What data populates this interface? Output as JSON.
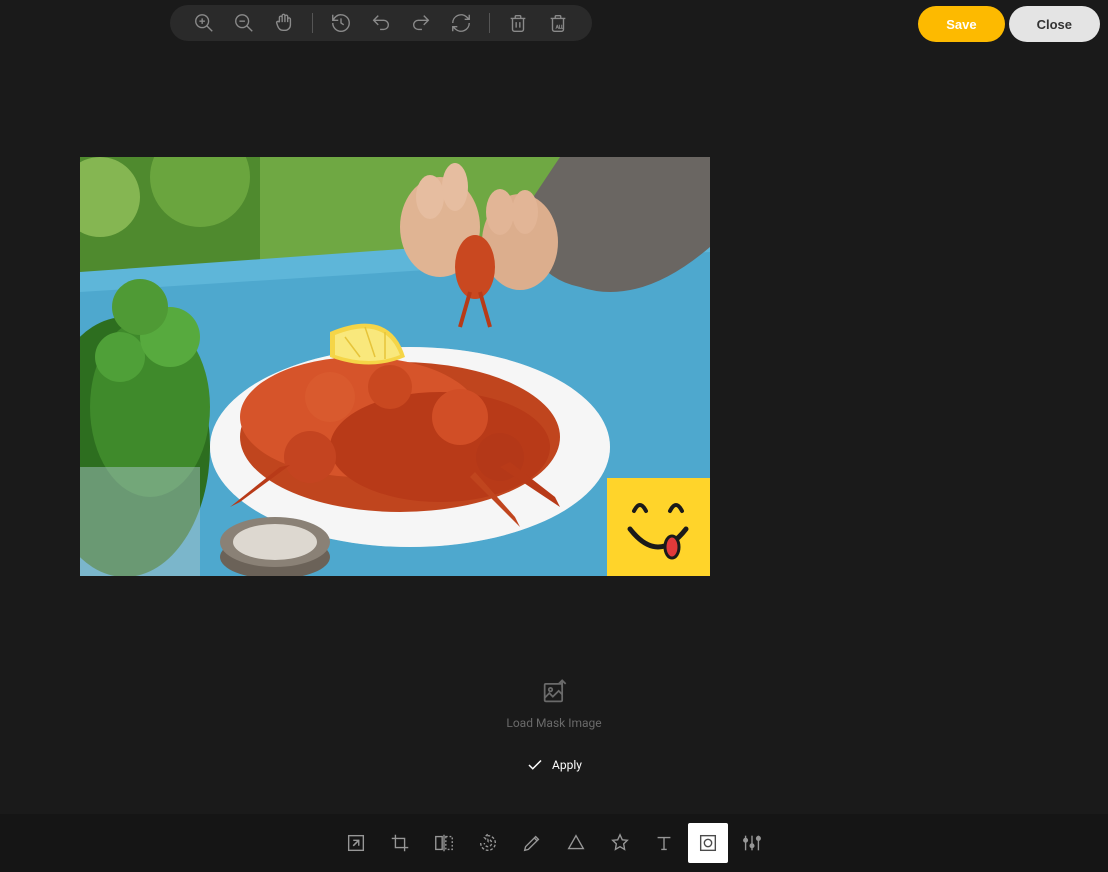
{
  "header": {
    "save_label": "Save",
    "close_label": "Close"
  },
  "mask": {
    "load_label": "Load Mask Image",
    "apply_label": "Apply"
  },
  "top_tools": {
    "zoom_in": "zoom-in",
    "zoom_out": "zoom-out",
    "hand": "hand",
    "history": "history",
    "undo": "undo",
    "redo": "redo",
    "reset": "reset",
    "delete": "delete",
    "delete_all": "delete-all"
  },
  "bottom_tools": {
    "resize": "resize",
    "crop": "crop",
    "flip": "flip",
    "rotate": "rotate",
    "draw": "draw",
    "shape": "shape",
    "icon": "icon",
    "text": "text",
    "mask": "mask",
    "filter": "filter"
  },
  "colors": {
    "accent": "#fdba00"
  }
}
